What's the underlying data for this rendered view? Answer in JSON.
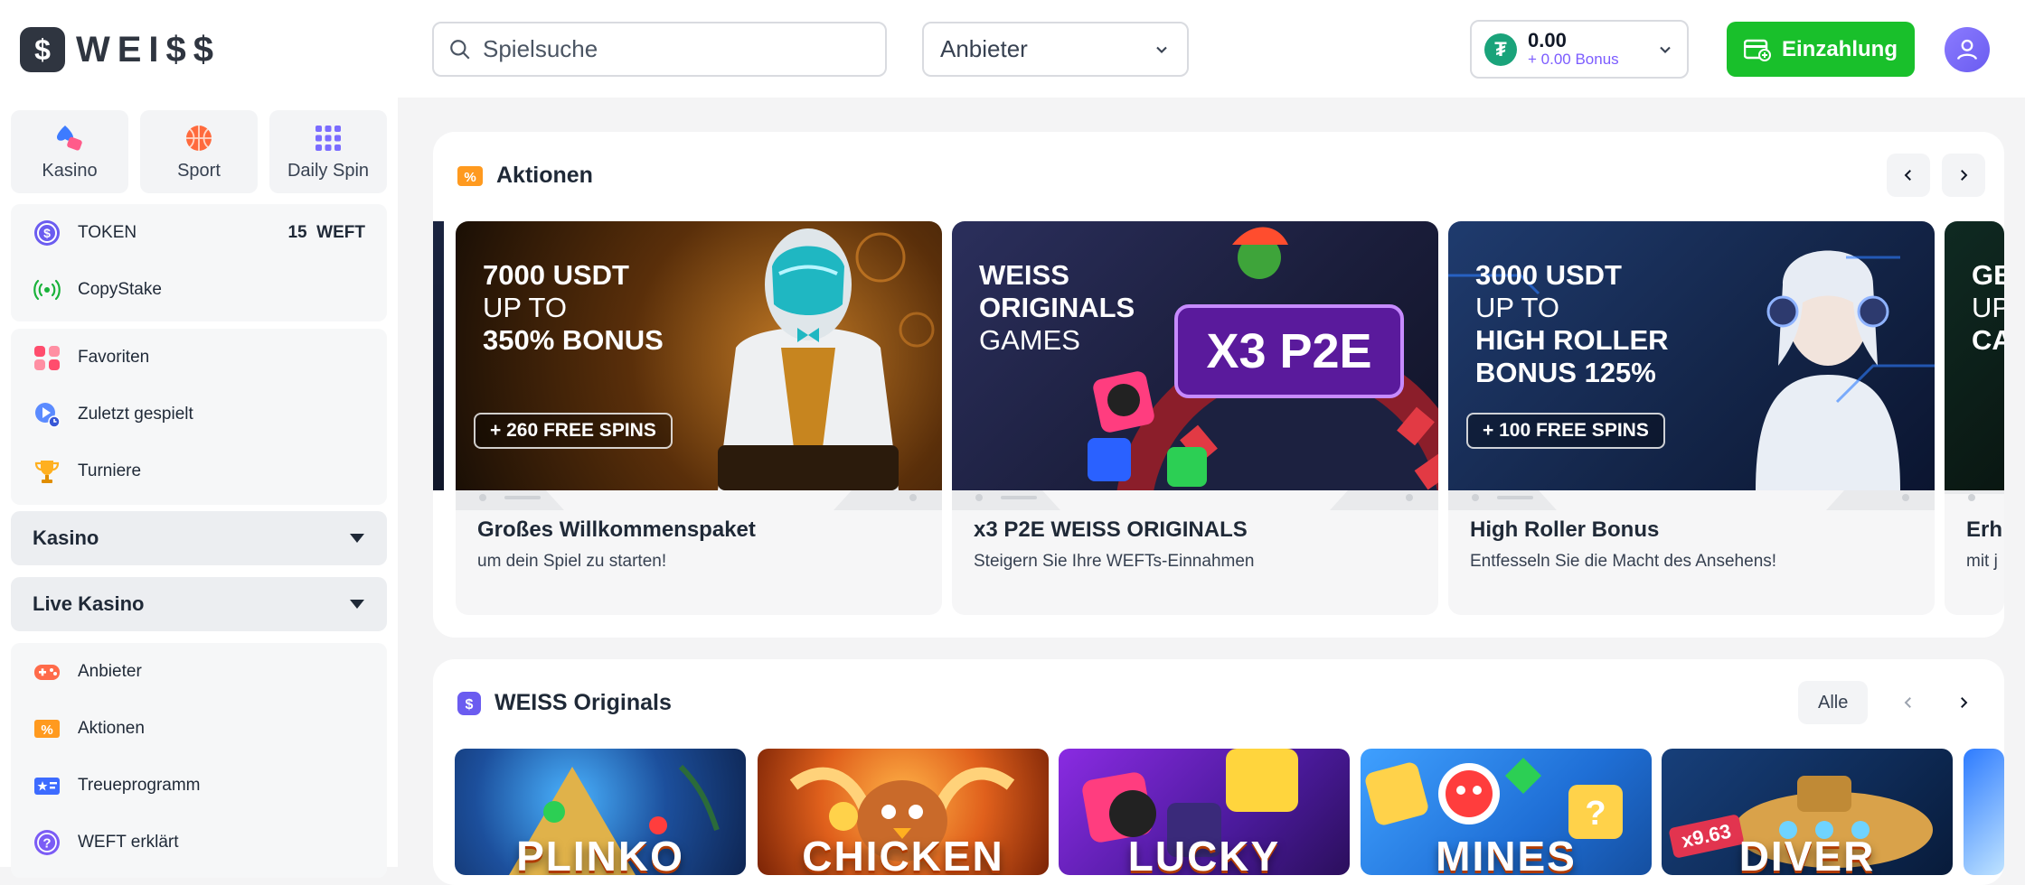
{
  "header": {
    "logo_text": "WEI$$",
    "search_placeholder": "Spielsuche",
    "provider_label": "Anbieter",
    "wallet_balance": "0.00",
    "wallet_bonus": "+ 0.00 Bonus",
    "deposit_label": "Einzahlung"
  },
  "sidebar": {
    "quick": [
      {
        "label": "Kasino",
        "icon": "spade-icon"
      },
      {
        "label": "Sport",
        "icon": "basketball-icon"
      },
      {
        "label": "Daily Spin",
        "icon": "dots-grid-icon"
      }
    ],
    "group1": [
      {
        "label": "TOKEN",
        "value": "15",
        "unit": "WEFT",
        "icon": "weiss-coin-icon"
      },
      {
        "label": "CopyStake",
        "icon": "broadcast-icon"
      }
    ],
    "group2": [
      {
        "label": "Favoriten",
        "icon": "favorites-icon"
      },
      {
        "label": "Zuletzt gespielt",
        "icon": "recent-play-icon"
      },
      {
        "label": "Turniere",
        "icon": "trophy-icon"
      }
    ],
    "dropdowns": [
      "Kasino",
      "Live Kasino"
    ],
    "group3": [
      {
        "label": "Anbieter",
        "icon": "gamepad-icon"
      },
      {
        "label": "Aktionen",
        "icon": "promo-ticket-icon"
      },
      {
        "label": "Treueprogramm",
        "icon": "loyalty-icon"
      },
      {
        "label": "WEFT erklärt",
        "icon": "question-icon"
      }
    ]
  },
  "promotions": {
    "title": "Aktionen",
    "cards": [
      {
        "line1": "7000 USDT",
        "line2": "UP TO",
        "line3": "350% BONUS",
        "spins": "+ 260 FREE SPINS",
        "title": "Großes Willkommenspaket",
        "subtitle": "um dein Spiel zu starten!"
      },
      {
        "line1": "WEISS",
        "line2": "ORIGINALS",
        "line3": "GAMES",
        "badge": "X3 P2E",
        "title": "x3 P2E WEISS ORIGINALS",
        "subtitle": "Steigern Sie Ihre WEFTs-Einnahmen"
      },
      {
        "line1": "3000 USDT",
        "line2": "UP TO",
        "line3": "HIGH ROLLER",
        "line4": "BONUS 125%",
        "spins": "+ 100 FREE SPINS",
        "title": "High Roller Bonus",
        "subtitle": "Entfesseln Sie die Macht des Ansehens!"
      },
      {
        "line1": "GE",
        "line2": "UP",
        "line3": "CA",
        "title": "Erh",
        "subtitle": "mit j"
      }
    ]
  },
  "originals": {
    "title": "WEISS Originals",
    "all_label": "Alle",
    "games": [
      {
        "name": "PLINKO"
      },
      {
        "name": "CHICKEN"
      },
      {
        "name": "LUCKY"
      },
      {
        "name": "MINES"
      },
      {
        "name": "DIVER",
        "badge": "x9.63"
      }
    ]
  }
}
